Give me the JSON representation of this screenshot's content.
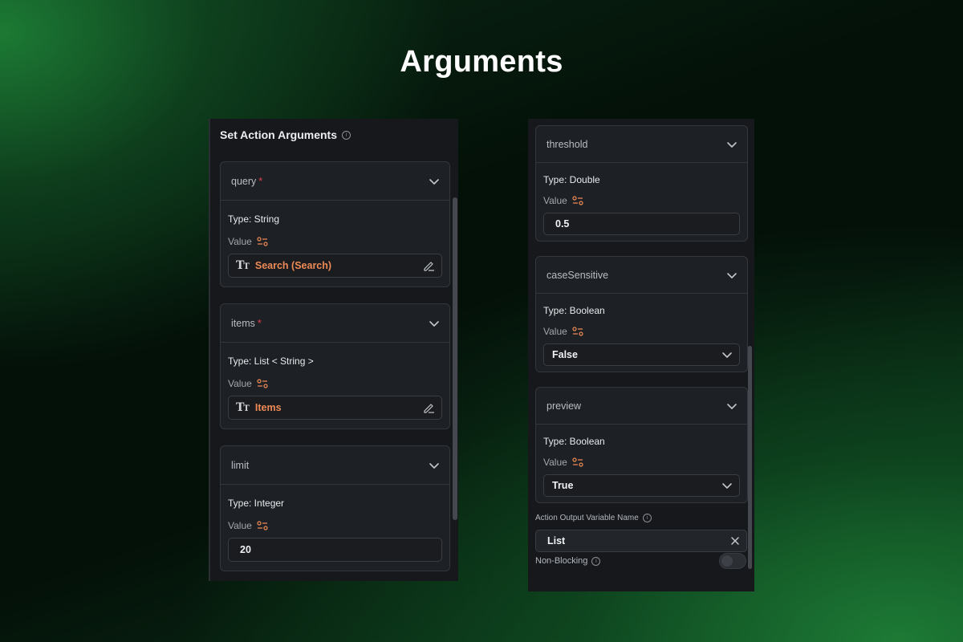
{
  "page": {
    "title": "Arguments"
  },
  "left_panel": {
    "heading": "Set Action Arguments",
    "cards": [
      {
        "name": "query",
        "required_marker": "*",
        "type_label": "Type: String",
        "value_label": "Value",
        "value": "Search (Search)",
        "value_style": "variable"
      },
      {
        "name": "items",
        "required_marker": "*",
        "type_label": "Type: List < String >",
        "value_label": "Value",
        "value": "Items",
        "value_style": "variable"
      },
      {
        "name": "limit",
        "required_marker": "",
        "type_label": "Type: Integer",
        "value_label": "Value",
        "value": "20",
        "value_style": "plain"
      }
    ]
  },
  "right_panel": {
    "cards": [
      {
        "name": "threshold",
        "type_label": "Type: Double",
        "value_label": "Value",
        "value": "0.5",
        "value_style": "plain"
      },
      {
        "name": "caseSensitive",
        "type_label": "Type: Boolean",
        "value_label": "Value",
        "value": "False",
        "value_style": "select"
      },
      {
        "name": "preview",
        "type_label": "Type: Boolean",
        "value_label": "Value",
        "value": "True",
        "value_style": "select"
      }
    ],
    "output_variable": {
      "label": "Action Output Variable Name",
      "value": "List"
    },
    "non_blocking": {
      "label": "Non-Blocking",
      "enabled": false
    }
  },
  "icons": {
    "chevron": "chevron-down-icon",
    "info": "info-icon",
    "value_settings": "sliders-icon",
    "text_type": "text-type-icon",
    "edit": "pencil-icon",
    "clear": "close-icon"
  },
  "colors": {
    "accent_orange": "#ee8a55",
    "required_red": "#e0414d",
    "panel_bg": "#16181b",
    "card_bg": "#1d2024"
  }
}
